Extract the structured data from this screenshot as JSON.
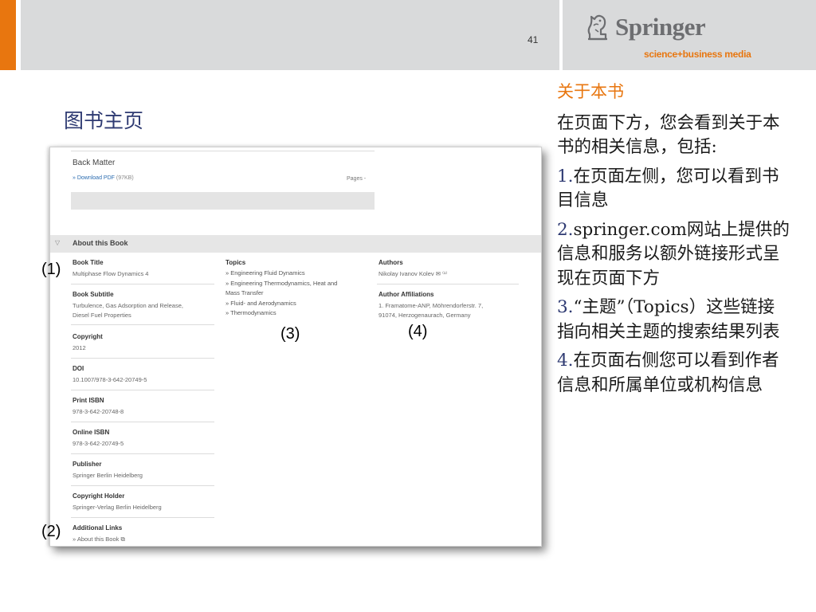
{
  "header": {
    "page_number": "41",
    "logo": {
      "word": "Springer",
      "tagline": "science+business media"
    }
  },
  "slide_title": "图书主页",
  "screenshot": {
    "back_matter": {
      "title": "Back Matter",
      "download_link": "» Download PDF",
      "download_size": "(97KB)",
      "pages": "Pages -"
    },
    "about_section": {
      "arrow": "▽",
      "title": "About this Book"
    },
    "left_column": [
      {
        "label": "Book Title",
        "values": [
          "Multiphase Flow Dynamics 4"
        ]
      },
      {
        "label": "Book Subtitle",
        "values": [
          "Turbulence, Gas Adsorption and Release,",
          "Diesel Fuel Properties"
        ]
      },
      {
        "label": "Copyright",
        "values": [
          "2012"
        ]
      },
      {
        "label": "DOI",
        "values": [
          "10.1007/978-3-642-20749-5"
        ]
      },
      {
        "label": "Print ISBN",
        "values": [
          "978-3-642-20748-8"
        ]
      },
      {
        "label": "Online ISBN",
        "values": [
          "978-3-642-20749-5"
        ]
      },
      {
        "label": "Publisher",
        "values": [
          "Springer Berlin Heidelberg"
        ]
      },
      {
        "label": "Copyright Holder",
        "values": [
          "Springer-Verlag Berlin Heidelberg"
        ]
      },
      {
        "label": "Additional Links",
        "values": [
          "» About this Book ⧉"
        ]
      }
    ],
    "topics": {
      "label": "Topics",
      "lines": [
        "» Engineering Fluid Dynamics",
        "» Engineering Thermodynamics, Heat and",
        "Mass Transfer",
        "» Fluid- and Aerodynamics",
        "» Thermodynamics"
      ]
    },
    "authors": {
      "label": "Authors",
      "value": "Nikolay Ivanov Kolev ✉ ⁽¹⁾"
    },
    "affiliations": {
      "label": "Author Affiliations",
      "values": [
        "1. Framatome-ANP, Möhrendorferstr. 7,",
        "91074, Herzogenaurach, Germany"
      ]
    }
  },
  "markers": [
    "(1)",
    "(2)",
    "(3)",
    "(4)"
  ],
  "side_text": {
    "heading": "关于本书",
    "intro": "在页面下方，您会看到关于本书的相关信息，包括:",
    "items": [
      {
        "num": "1.",
        "text": "在页面左侧，您可以看到书目信息"
      },
      {
        "num": "2.",
        "text": "springer.com网站上提供的信息和服务以额外链接形式呈现在页面下方"
      },
      {
        "num": "3.",
        "text": "“主题”（Topics）这些链接指向相关主题的搜索结果列表"
      },
      {
        "num": "4.",
        "text": "在页面右侧您可以看到作者信息和所属单位或机构信息"
      }
    ]
  },
  "colors": {
    "orange": "#e8760f",
    "navy": "#2e3a72",
    "band_gray": "#d9dadb"
  }
}
